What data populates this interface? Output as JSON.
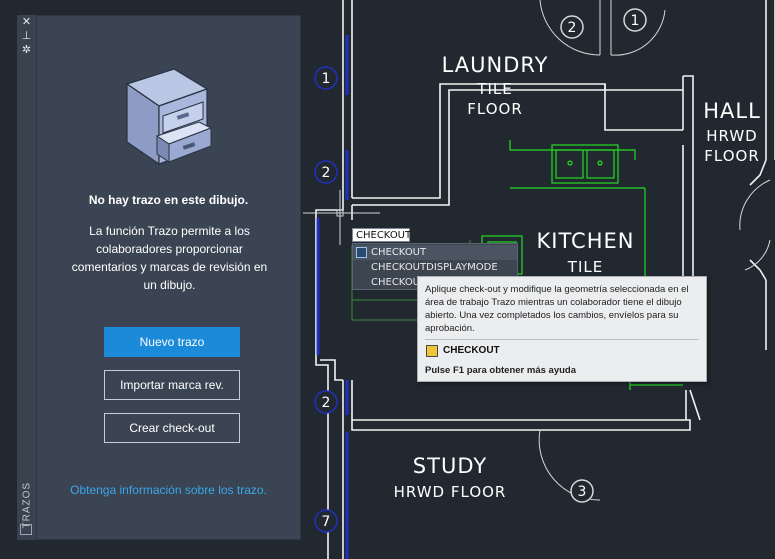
{
  "drawing": {
    "rooms": [
      {
        "name": "LAUNDRY",
        "finish1": "TILE",
        "finish2": "FLOOR"
      },
      {
        "name": "HALL",
        "finish1": "HRWD",
        "finish2": "FLOOR"
      },
      {
        "name": "KITCHEN",
        "finish1": "TILE",
        "finish2": ""
      },
      {
        "name": "STUDY",
        "finish1": "HRWD FLOOR",
        "finish2": ""
      }
    ],
    "tags": [
      "1",
      "2",
      "2",
      "7",
      "2",
      "1",
      "3"
    ]
  },
  "panel_strip": {
    "title": "TRAZOS",
    "close_glyph": "✕",
    "pin_glyph": "⊥",
    "settings_glyph": "✲"
  },
  "markup_panel": {
    "empty_title": "No hay trazo en este dibujo.",
    "empty_description": "La función Trazo permite a los colaboradores proporcionar comentarios y marcas de revisión en un dibujo.",
    "new_trace_button": "Nuevo trazo",
    "import_markup_button": "Importar marca rev.",
    "create_checkout_button": "Crear check-out",
    "learn_link": "Obtenga información sobre los trazo."
  },
  "command_line": {
    "input": "CHECKOUT",
    "suggestions": [
      "CHECKOUT",
      "CHECKOUTDISPLAYMODE",
      "CHECKOUT"
    ]
  },
  "tooltip": {
    "description": "Aplique check-out y modifique la geometría seleccionada en el área de trabajo Trazo mientras un colaborador tiene el dibujo abierto. Una vez completados los cambios, envíelos para su aprobación.",
    "command": "CHECKOUT",
    "help": "Pulse F1 para obtener más ayuda"
  },
  "colors": {
    "background": "#212830",
    "wall": "#ffffff",
    "cabinet": "#22dd22",
    "grid_bubble": "#2030c0",
    "panel": "#3b4453",
    "accent": "#1a8ad9",
    "link": "#38a8e8"
  }
}
